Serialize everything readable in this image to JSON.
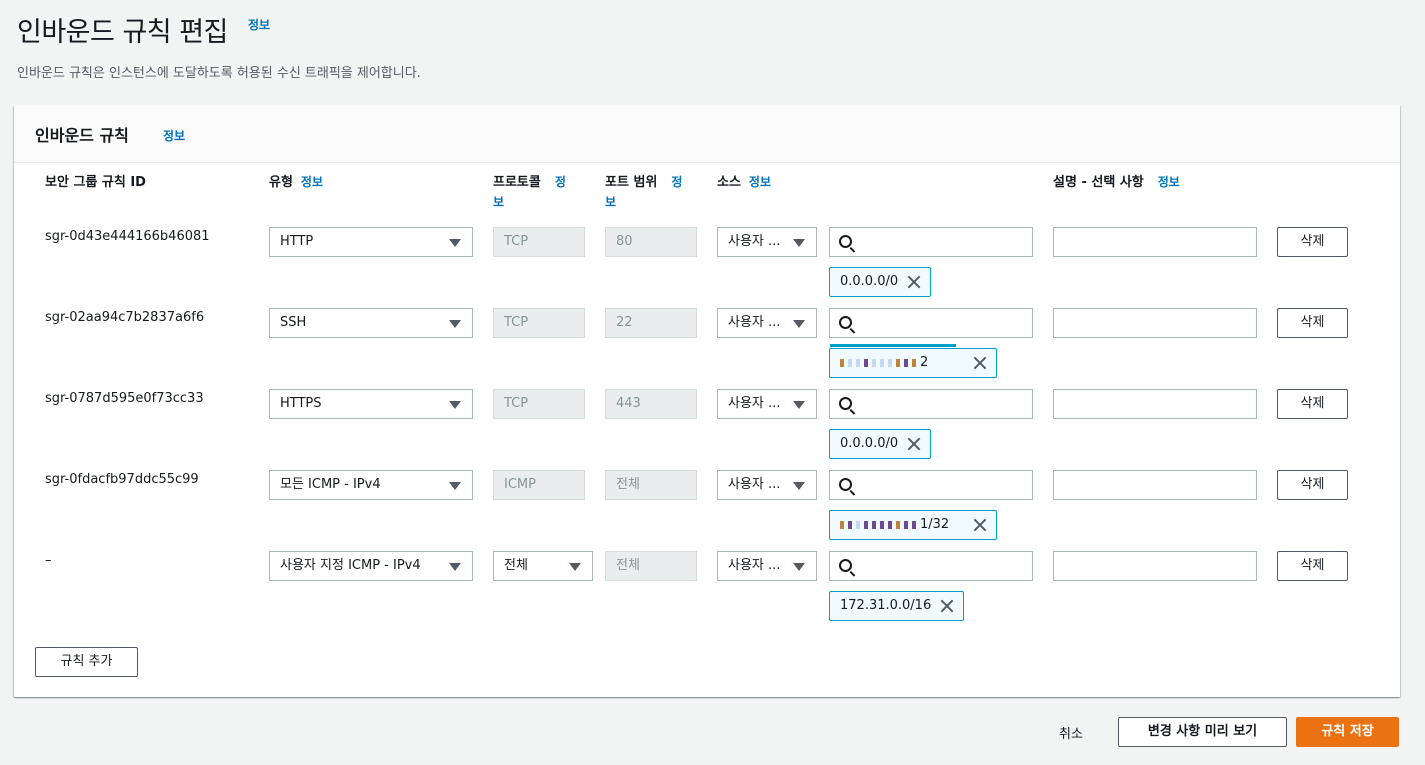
{
  "page": {
    "title": "인바운드 규칙 편집",
    "info": "정보",
    "description": "인바운드 규칙은 인스턴스에 도달하도록 허용된 수신 트래픽을 제어합니다."
  },
  "panel": {
    "title": "인바운드 규칙",
    "info": "정보",
    "columns": {
      "rule_id": "보안 그룹 규칙 ID",
      "type": "유형",
      "protocol": "프로토콜",
      "port_range": "포트 범위",
      "source": "소스",
      "description": "설명 - 선택 사항",
      "info": "정보",
      "info_a": "정",
      "info_b": "보"
    },
    "rules": [
      {
        "id": "sgr-0d43e444166b46081",
        "type": "HTTP",
        "protocol": "TCP",
        "port": "80",
        "source": "사용자 ...",
        "cidr": "0.0.0.0/0",
        "delete": "삭제"
      },
      {
        "id": "sgr-02aa94c7b2837a6f6",
        "type": "SSH",
        "protocol": "TCP",
        "port": "22",
        "source": "사용자 ...",
        "cidr": "2",
        "delete": "삭제"
      },
      {
        "id": "sgr-0787d595e0f73cc33",
        "type": "HTTPS",
        "protocol": "TCP",
        "port": "443",
        "source": "사용자 ...",
        "cidr": "0.0.0.0/0",
        "delete": "삭제"
      },
      {
        "id": "sgr-0fdacfb97ddc55c99",
        "type": "모든 ICMP - IPv4",
        "protocol": "ICMP",
        "port": "전체",
        "source": "사용자 ...",
        "cidr": "1/32",
        "delete": "삭제"
      },
      {
        "id": "–",
        "type": "사용자 지정 ICMP - IPv4",
        "protocol": "전체",
        "port": "전체",
        "source": "사용자 ...",
        "cidr": "172.31.0.0/16",
        "delete": "삭제"
      }
    ],
    "add_rule": "규칙 추가"
  },
  "footer": {
    "cancel": "취소",
    "preview": "변경 사항 미리 보기",
    "save": "규칙 저장"
  },
  "colors": {
    "accent": "#ec7211",
    "link": "#0073bb",
    "token_border": "#00a1c9"
  }
}
